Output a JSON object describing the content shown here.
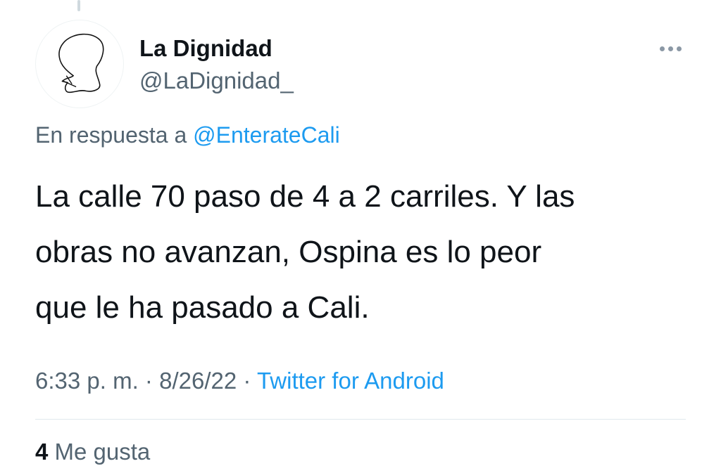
{
  "tweet": {
    "author": {
      "display_name": "La Dignidad",
      "handle": "@LaDignidad_"
    },
    "reply_prefix": "En respuesta a",
    "reply_mention": "@EnterateCali",
    "text_lines": [
      "La calle 70 paso de 4 a 2 carriles. Y las",
      "obras no avanzan, Ospina es lo peor",
      "que le ha pasado a Cali."
    ],
    "time": "6:33 p. m.",
    "separator": "·",
    "date": "8/26/22",
    "source": "Twitter for Android",
    "likes_count": "4",
    "likes_label": "Me gusta"
  },
  "icons": {
    "more": "more-horizontal-icon",
    "avatar": "avatar-line-drawing"
  },
  "colors": {
    "text": "#0f1419",
    "secondary": "#536471",
    "link": "#1d9bf0",
    "divider": "#e1e8ed"
  }
}
